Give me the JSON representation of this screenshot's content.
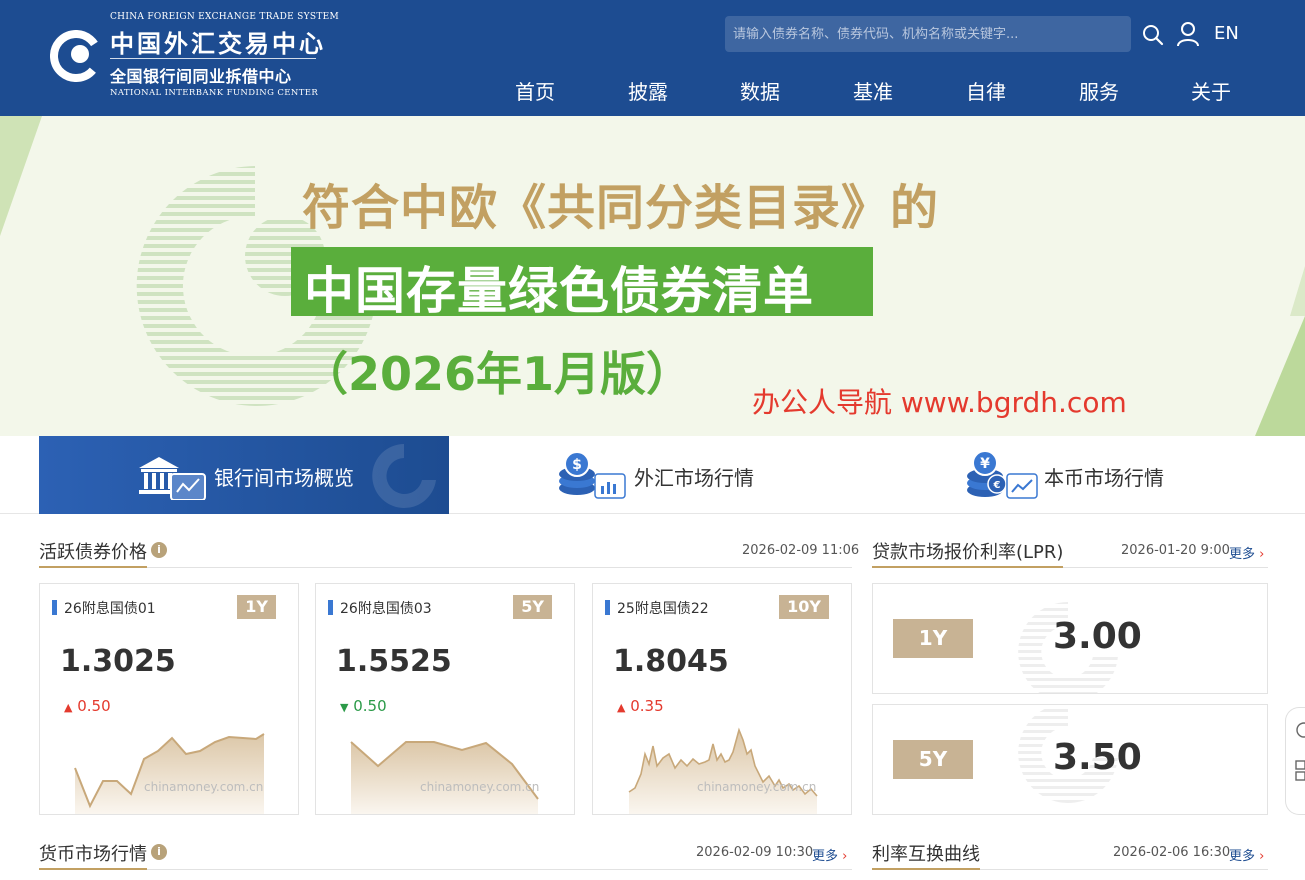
{
  "header": {
    "logo_en_top": "CHINA FOREIGN EXCHANGE TRADE SYSTEM",
    "logo_cn_big": "中国外汇交易中心",
    "logo_cn_small": "全国银行间同业拆借中心",
    "logo_en_bottom": "NATIONAL INTERBANK FUNDING CENTER",
    "search_placeholder": "请输入债券名称、债券代码、机构名称或关键字...",
    "lang": "EN",
    "nav": [
      "首页",
      "披露",
      "数据",
      "基准",
      "自律",
      "服务",
      "关于"
    ]
  },
  "banner": {
    "line1": "符合中欧《共同分类目录》的",
    "line2": "中国存量绿色债券清单",
    "line3": "（2026年1月版）",
    "watermark": "办公人导航  www.bgrdh.com"
  },
  "tabs": [
    "银行间市场概览",
    "外汇市场行情",
    "本币市场行情"
  ],
  "active_bonds": {
    "title": "活跃债券价格",
    "time": "2026-02-09 11:06",
    "cards": [
      {
        "name": "26附息国债01",
        "tenor": "1Y",
        "price": "1.3025",
        "direction": "up",
        "arrow": "▲",
        "change": "0.50",
        "watermark": "chinamoney.com.cn"
      },
      {
        "name": "26附息国债03",
        "tenor": "5Y",
        "price": "1.5525",
        "direction": "down",
        "arrow": "▼",
        "change": "0.50",
        "watermark": "chinamoney.com.cn"
      },
      {
        "name": "25附息国债22",
        "tenor": "10Y",
        "price": "1.8045",
        "direction": "up",
        "arrow": "▲",
        "change": "0.35",
        "watermark": "chinamoney.com.cn"
      }
    ]
  },
  "lpr": {
    "title": "贷款市场报价利率(LPR)",
    "time": "2026-01-20 9:00",
    "more": "更多",
    "items": [
      {
        "tenor": "1Y",
        "value": "3.00"
      },
      {
        "tenor": "5Y",
        "value": "3.50"
      }
    ]
  },
  "money_market": {
    "title": "货币市场行情",
    "time": "2026-02-09 10:30",
    "more": "更多"
  },
  "irs": {
    "title": "利率互换曲线",
    "time": "2026-02-06 16:30",
    "more": "更多"
  },
  "colors": {
    "header_bg": "#1d4c91",
    "gold": "#c2a062",
    "green": "#5aae3c",
    "up": "#e43a2e",
    "down": "#2b9a48"
  }
}
